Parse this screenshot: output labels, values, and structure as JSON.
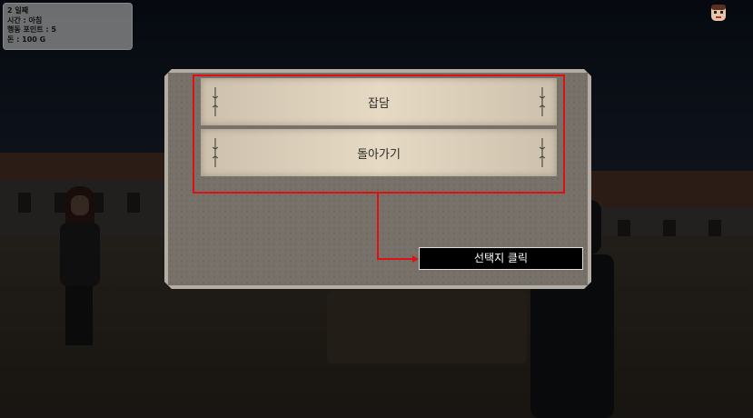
{
  "hud": {
    "day": "2 일째",
    "time": "시간 : 아침",
    "action_points": "행동 포인트 : 5",
    "money": "돈 : 100 G"
  },
  "dialog": {
    "choices": [
      "잡담",
      "돌아가기"
    ]
  },
  "tutorial": {
    "callout": "선택지 클릭"
  },
  "colors": {
    "highlight": "#dd1111",
    "panel": "#77716a",
    "choice": "#e0d4bf"
  }
}
